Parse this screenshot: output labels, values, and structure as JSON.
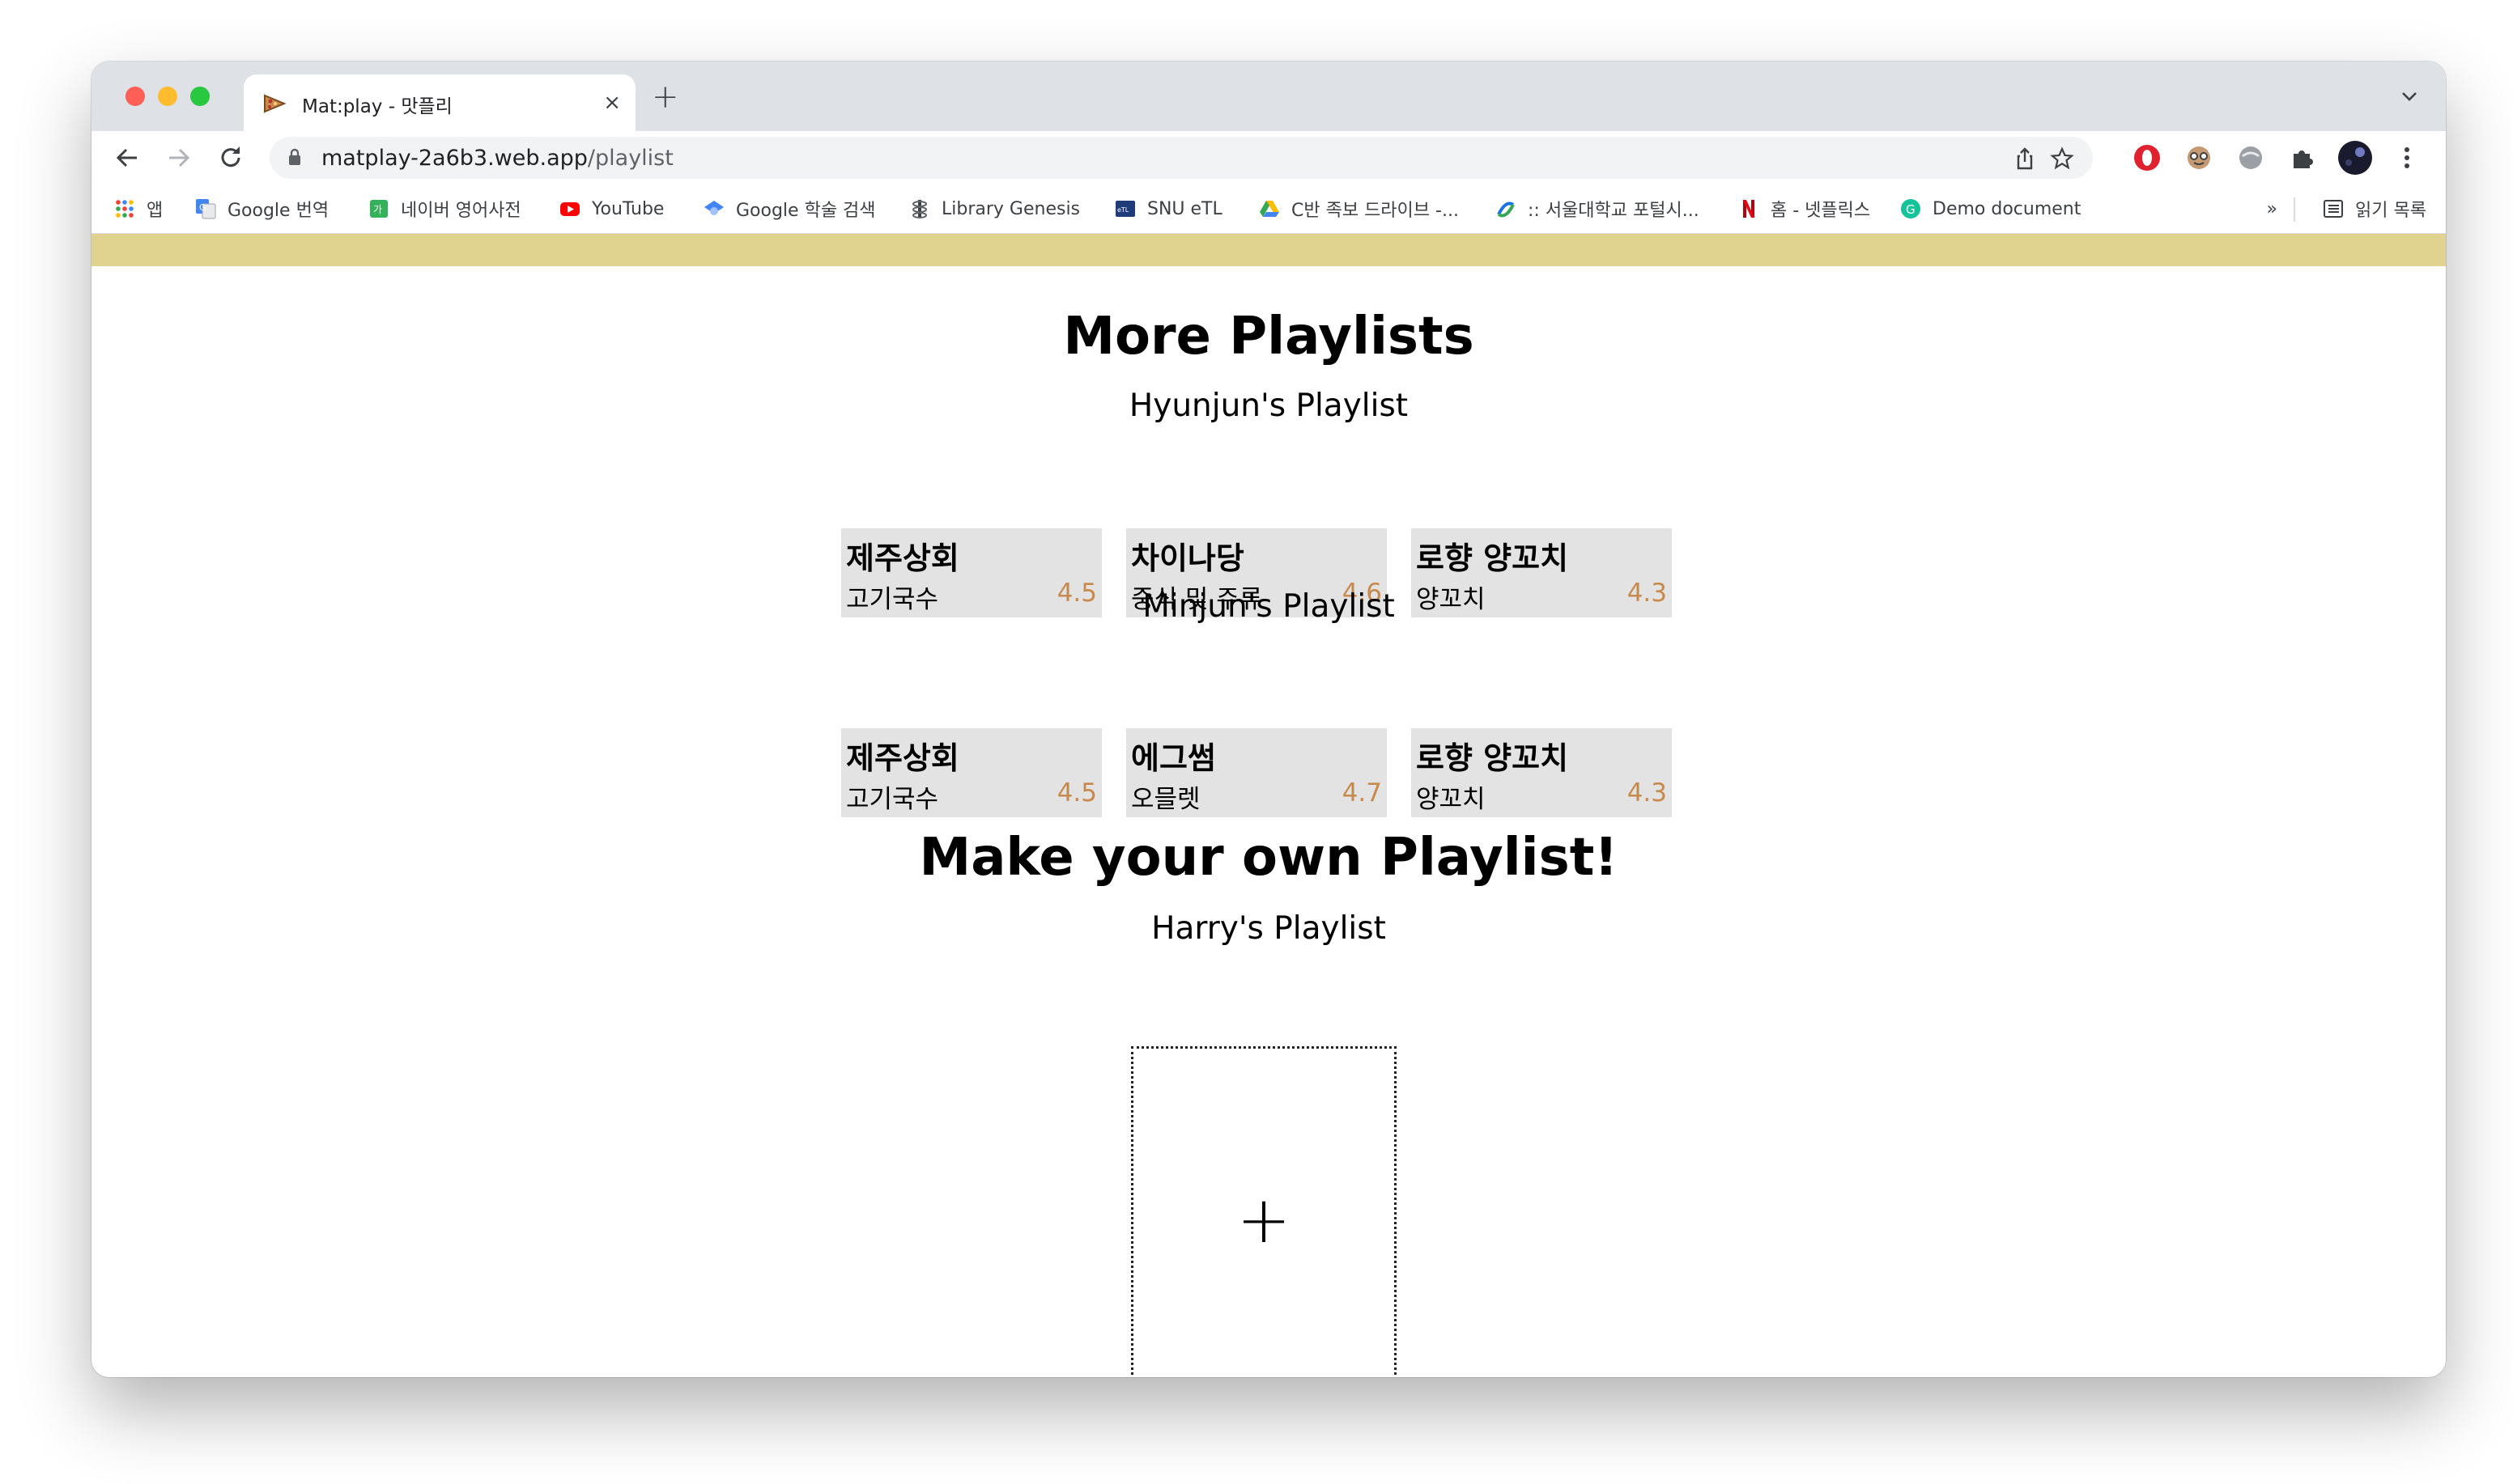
{
  "browser": {
    "tab_title": "Mat:play - 맛플리",
    "tab_close": "×",
    "new_tab": "+",
    "url_host": "matplay-2a6b3.web.app",
    "url_path": "/playlist",
    "bookmarks": [
      {
        "label": "앱",
        "icon": "apps-grid-icon"
      },
      {
        "label": "Google 번역",
        "icon": "google-translate-icon"
      },
      {
        "label": "네이버 영어사전",
        "icon": "naver-dictionary-icon"
      },
      {
        "label": "YouTube",
        "icon": "youtube-icon"
      },
      {
        "label": "Google 학술 검색",
        "icon": "google-scholar-icon"
      },
      {
        "label": "Library Genesis",
        "icon": "library-genesis-icon"
      },
      {
        "label": "SNU eTL",
        "icon": "etl-icon"
      },
      {
        "label": "C반 족보 드라이브 -...",
        "icon": "google-drive-icon"
      },
      {
        "label": ":: 서울대학교 포털시...",
        "icon": "snu-portal-icon"
      },
      {
        "label": "홈 - 넷플릭스",
        "icon": "netflix-icon"
      },
      {
        "label": "Demo document",
        "icon": "grammarly-icon"
      }
    ],
    "bookmarks_overflow": "»",
    "reading_list": "읽기 목록",
    "colors": {
      "chrome_bar": "#dee1e6",
      "banner": "#e0d28f"
    }
  },
  "page": {
    "more_title": "More Playlists",
    "playlists": [
      {
        "title": "Hyunjun's Playlist",
        "items": [
          {
            "name": "제주상회",
            "category": "고기국수",
            "rating": "4.5"
          },
          {
            "name": "차이나당",
            "category": "중식 및 주류",
            "rating": "4.6"
          },
          {
            "name": "로향 양꼬치",
            "category": "양꼬치",
            "rating": "4.3"
          }
        ]
      },
      {
        "title": "Minjun's Playlist",
        "items": [
          {
            "name": "제주상회",
            "category": "고기국수",
            "rating": "4.5"
          },
          {
            "name": "에그썸",
            "category": "오믈렛",
            "rating": "4.7"
          },
          {
            "name": "로향 양꼬치",
            "category": "양꼬치",
            "rating": "4.3"
          }
        ]
      }
    ],
    "make_title": "Make your own Playlist!",
    "own_playlist_title": "Harry's Playlist",
    "add_symbol": "+",
    "colors": {
      "card_bg": "#e3e3e3",
      "rating": "#c8894a"
    }
  }
}
